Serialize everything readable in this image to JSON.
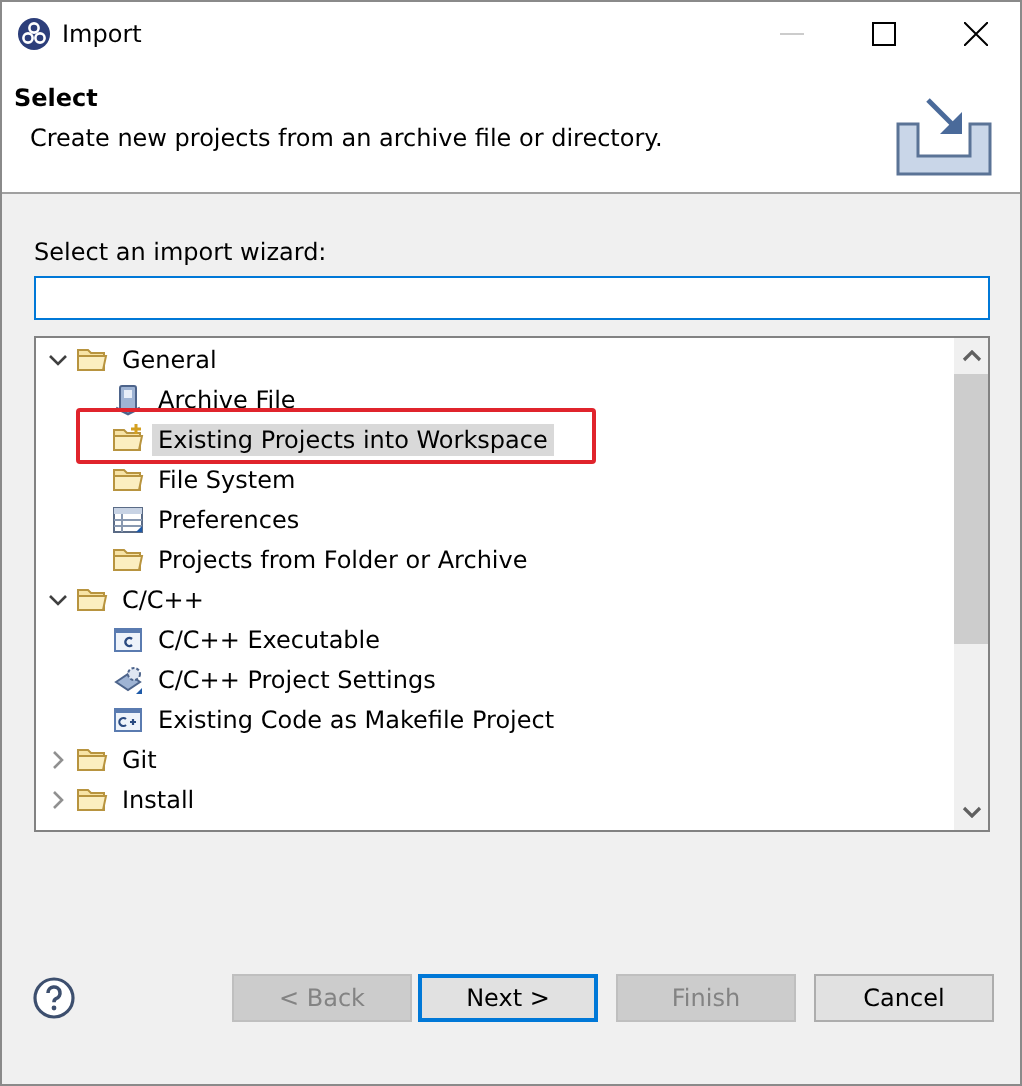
{
  "window": {
    "title": "Import"
  },
  "header": {
    "title": "Select",
    "description": "Create new projects from an archive file or directory."
  },
  "wizard_label": "Select an import wizard:",
  "tree": [
    {
      "label": "General",
      "kind": "folder",
      "expanded": true,
      "selected": false,
      "children": [
        {
          "label": "Archive File",
          "kind": "archive",
          "selected": false
        },
        {
          "label": "Existing Projects into Workspace",
          "kind": "project-folder",
          "selected": true,
          "highlighted": true
        },
        {
          "label": "File System",
          "kind": "folder",
          "selected": false
        },
        {
          "label": "Preferences",
          "kind": "table",
          "selected": false
        },
        {
          "label": "Projects from Folder or Archive",
          "kind": "folder",
          "selected": false
        }
      ]
    },
    {
      "label": "C/C++",
      "kind": "folder",
      "expanded": true,
      "selected": false,
      "children": [
        {
          "label": "C/C++ Executable",
          "kind": "c-file",
          "selected": false
        },
        {
          "label": "C/C++ Project Settings",
          "kind": "settings",
          "selected": false
        },
        {
          "label": "Existing Code as Makefile Project",
          "kind": "cpp-file",
          "selected": false
        }
      ]
    },
    {
      "label": "Git",
      "kind": "folder",
      "expanded": false,
      "selected": false
    },
    {
      "label": "Install",
      "kind": "folder",
      "expanded": false,
      "selected": false
    }
  ],
  "buttons": [
    {
      "label": "< Back",
      "disabled": true,
      "default": false
    },
    {
      "label": "Next >",
      "disabled": false,
      "default": true
    },
    {
      "label": "Finish",
      "disabled": true,
      "default": false
    },
    {
      "label": "Cancel",
      "disabled": false,
      "default": false
    }
  ]
}
